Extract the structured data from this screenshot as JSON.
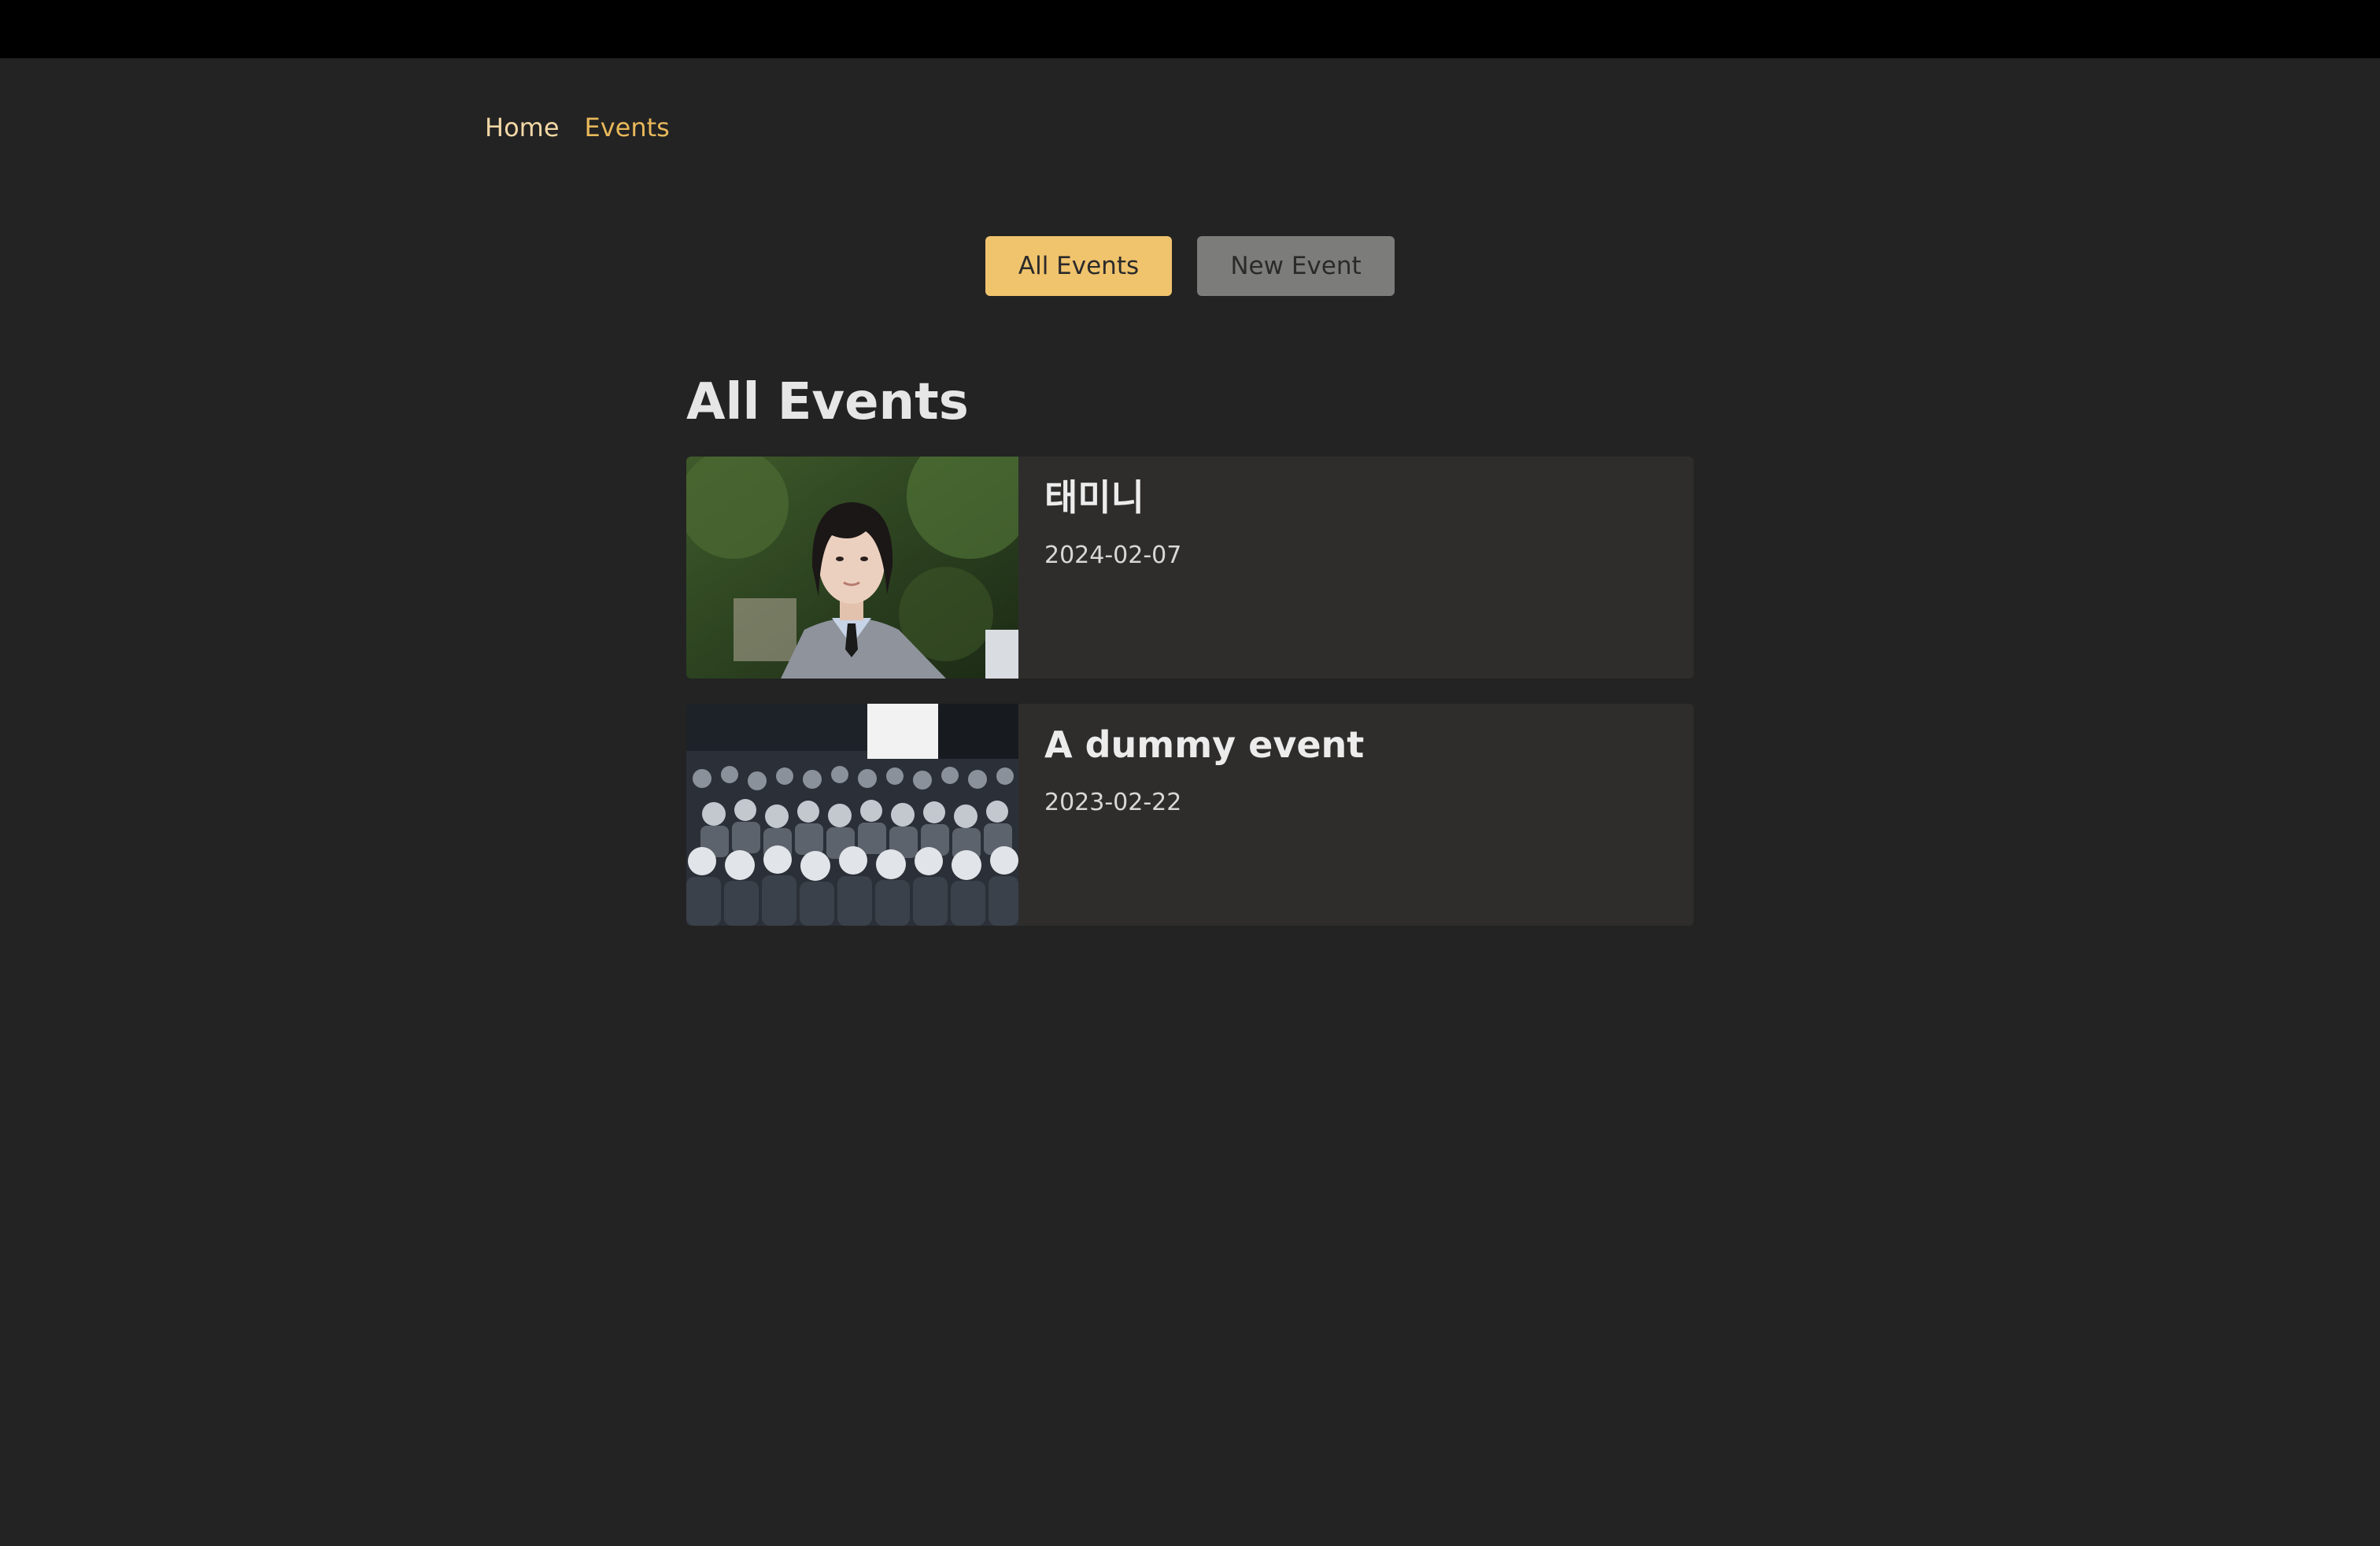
{
  "nav": {
    "items": [
      {
        "label": "Home",
        "color": "#f2d7a5"
      },
      {
        "label": "Events",
        "color": "#e8b85a"
      }
    ]
  },
  "actions": {
    "all_events": "All Events",
    "new_event": "New Event"
  },
  "page": {
    "title": "All Events"
  },
  "events": [
    {
      "title": "태미니",
      "date": "2024-02-07",
      "image": "portrait-photo"
    },
    {
      "title": "A dummy event",
      "date": "2023-02-22",
      "image": "crowd-photo"
    }
  ],
  "colors": {
    "background": "#232323",
    "topbar": "#000000",
    "accent": "#f0c36d",
    "secondary_button": "#7c7c7a",
    "card": "#2e2d2c"
  }
}
